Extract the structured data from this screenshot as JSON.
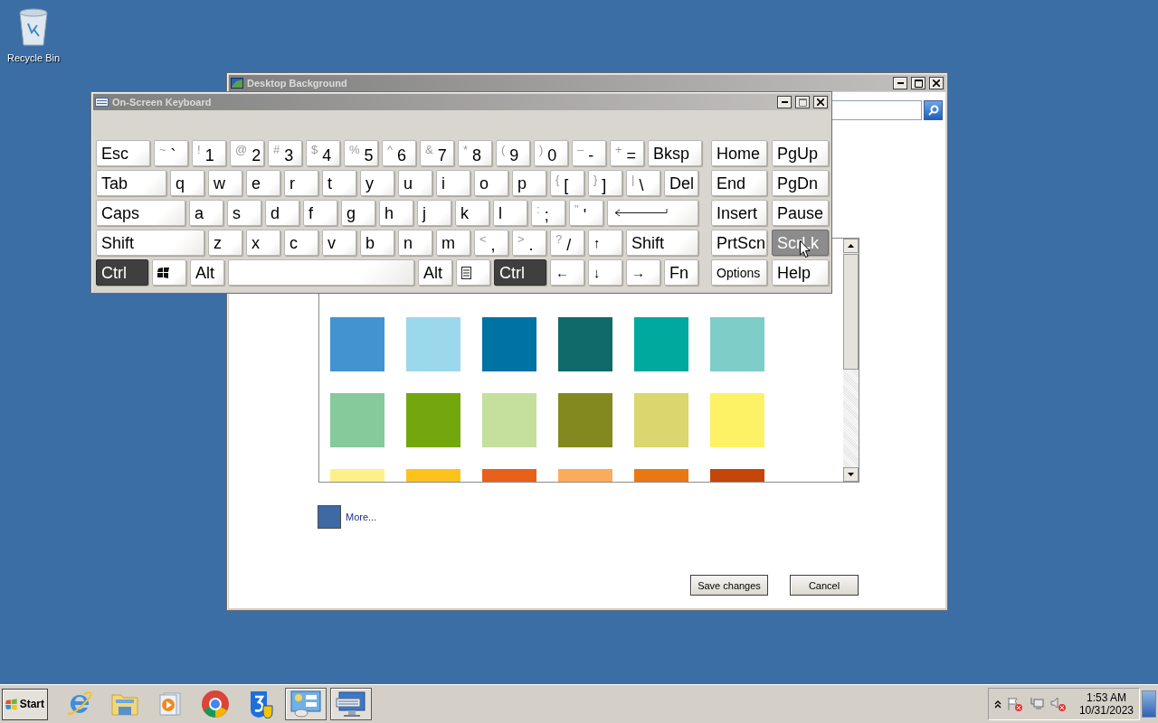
{
  "desktop": {
    "icons": [
      {
        "label": "Recycle Bin"
      }
    ]
  },
  "background_window": {
    "title": "Desktop Background",
    "swatch_rows": [
      [
        {
          "color": "#4393d0"
        },
        {
          "color": "#9cd8ec"
        },
        {
          "color": "#0072a3"
        },
        {
          "color": "#106a6a"
        },
        {
          "color": "#00a99d"
        },
        {
          "color": "#7ecdc8"
        }
      ],
      [
        {
          "color": "#86c99a"
        },
        {
          "color": "#72a80e"
        },
        {
          "color": "#c4e09c"
        },
        {
          "color": "#83891e"
        },
        {
          "color": "#dbd66e"
        },
        {
          "color": "#fdf266"
        }
      ],
      [
        {
          "color": "#fdf08a"
        },
        {
          "color": "#fec31b"
        },
        {
          "color": "#e8601c"
        },
        {
          "color": "#fcab5e"
        },
        {
          "color": "#e97812"
        },
        {
          "color": "#c44608"
        }
      ]
    ],
    "more": {
      "color": "#3d6aa3",
      "label": "More..."
    },
    "buttons": [
      "Save changes",
      "Cancel"
    ]
  },
  "keyboard_window": {
    "title": "On-Screen Keyboard",
    "key_rows": [
      {
        "keys": [
          {
            "kind": "text",
            "label": "Esc",
            "pressed": false,
            "hovered": false
          },
          {
            "kind": "text",
            "shift": "~",
            "label": "`",
            "pressed": false,
            "hovered": false
          },
          {
            "kind": "text",
            "shift": "!",
            "label": "1",
            "pressed": false,
            "hovered": false
          },
          {
            "kind": "text",
            "shift": "@",
            "label": "2",
            "pressed": false,
            "hovered": false
          },
          {
            "kind": "text",
            "shift": "#",
            "label": "3",
            "pressed": false,
            "hovered": false
          },
          {
            "kind": "text",
            "shift": "$",
            "label": "4",
            "pressed": false,
            "hovered": false
          },
          {
            "kind": "text",
            "shift": "%",
            "label": "5",
            "pressed": false,
            "hovered": false
          },
          {
            "kind": "text",
            "shift": "^",
            "label": "6",
            "pressed": false,
            "hovered": false
          },
          {
            "kind": "text",
            "shift": "&",
            "label": "7",
            "pressed": false,
            "hovered": false
          },
          {
            "kind": "text",
            "shift": "*",
            "label": "8",
            "pressed": false,
            "hovered": false
          },
          {
            "kind": "text",
            "shift": "(",
            "label": "9",
            "pressed": false,
            "hovered": false
          },
          {
            "kind": "text",
            "shift": ")",
            "label": "0",
            "pressed": false,
            "hovered": false
          },
          {
            "kind": "text",
            "shift": "–",
            "label": "-",
            "pressed": false,
            "hovered": false
          },
          {
            "kind": "text",
            "shift": "+",
            "label": "=",
            "pressed": false,
            "hovered": false
          },
          {
            "kind": "text",
            "label": "Bksp",
            "pressed": false,
            "hovered": false
          }
        ]
      },
      {
        "keys": [
          {
            "kind": "text",
            "label": "Tab",
            "pressed": false,
            "hovered": false
          },
          {
            "kind": "text",
            "label": "q",
            "pressed": false,
            "hovered": false
          },
          {
            "kind": "text",
            "label": "w",
            "pressed": false,
            "hovered": false
          },
          {
            "kind": "text",
            "label": "e",
            "pressed": false,
            "hovered": false
          },
          {
            "kind": "text",
            "label": "r",
            "pressed": false,
            "hovered": false
          },
          {
            "kind": "text",
            "label": "t",
            "pressed": false,
            "hovered": false
          },
          {
            "kind": "text",
            "label": "y",
            "pressed": false,
            "hovered": false
          },
          {
            "kind": "text",
            "label": "u",
            "pressed": false,
            "hovered": false
          },
          {
            "kind": "text",
            "label": "i",
            "pressed": false,
            "hovered": false
          },
          {
            "kind": "text",
            "label": "o",
            "pressed": false,
            "hovered": false
          },
          {
            "kind": "text",
            "label": "p",
            "pressed": false,
            "hovered": false
          },
          {
            "kind": "text",
            "shift": "{",
            "label": "[",
            "pressed": false,
            "hovered": false
          },
          {
            "kind": "text",
            "shift": "}",
            "label": "]",
            "pressed": false,
            "hovered": false
          },
          {
            "kind": "text",
            "shift": "|",
            "label": "\\",
            "pressed": false,
            "hovered": false
          },
          {
            "kind": "text",
            "label": "Del",
            "pressed": false,
            "hovered": false
          }
        ]
      },
      {
        "keys": [
          {
            "kind": "text",
            "label": "Caps",
            "pressed": false,
            "hovered": false
          },
          {
            "kind": "text",
            "label": "a",
            "pressed": false,
            "hovered": false
          },
          {
            "kind": "text",
            "label": "s",
            "pressed": false,
            "hovered": false
          },
          {
            "kind": "text",
            "label": "d",
            "pressed": false,
            "hovered": false
          },
          {
            "kind": "text",
            "label": "f",
            "pressed": false,
            "hovered": false
          },
          {
            "kind": "text",
            "label": "g",
            "pressed": false,
            "hovered": false
          },
          {
            "kind": "text",
            "label": "h",
            "pressed": false,
            "hovered": false
          },
          {
            "kind": "text",
            "label": "j",
            "pressed": false,
            "hovered": false
          },
          {
            "kind": "text",
            "label": "k",
            "pressed": false,
            "hovered": false
          },
          {
            "kind": "text",
            "label": "l",
            "pressed": false,
            "hovered": false
          },
          {
            "kind": "text",
            "shift": ":",
            "label": ";",
            "pressed": false,
            "hovered": false
          },
          {
            "kind": "text",
            "shift": "\"",
            "label": "'",
            "pressed": false,
            "hovered": false
          },
          {
            "kind": "enter",
            "pressed": false,
            "hovered": false
          }
        ]
      },
      {
        "keys": [
          {
            "kind": "text",
            "label": "Shift",
            "pressed": false,
            "hovered": false
          },
          {
            "kind": "text",
            "label": "z",
            "pressed": false,
            "hovered": false
          },
          {
            "kind": "text",
            "label": "x",
            "pressed": false,
            "hovered": false
          },
          {
            "kind": "text",
            "label": "c",
            "pressed": false,
            "hovered": false
          },
          {
            "kind": "text",
            "label": "v",
            "pressed": false,
            "hovered": false
          },
          {
            "kind": "text",
            "label": "b",
            "pressed": false,
            "hovered": false
          },
          {
            "kind": "text",
            "label": "n",
            "pressed": false,
            "hovered": false
          },
          {
            "kind": "text",
            "label": "m",
            "pressed": false,
            "hovered": false
          },
          {
            "kind": "text",
            "shift": "<",
            "label": ",",
            "pressed": false,
            "hovered": false
          },
          {
            "kind": "text",
            "shift": ">",
            "label": ".",
            "pressed": false,
            "hovered": false
          },
          {
            "kind": "text",
            "shift": "?",
            "label": "/",
            "pressed": false,
            "hovered": false
          },
          {
            "kind": "text",
            "shift": "↑",
            "pressed": false,
            "hovered": false
          },
          {
            "kind": "text",
            "label": "Shift",
            "pressed": false,
            "hovered": false
          }
        ]
      },
      {
        "keys": [
          {
            "kind": "text",
            "label": "Ctrl",
            "pressed": true,
            "hovered": false
          },
          {
            "kind": "windows",
            "pressed": false,
            "hovered": false
          },
          {
            "kind": "text",
            "label": "Alt",
            "pressed": false,
            "hovered": false
          },
          {
            "kind": "space",
            "pressed": false,
            "hovered": false
          },
          {
            "kind": "text",
            "label": "Alt",
            "pressed": false,
            "hovered": false
          },
          {
            "kind": "menu",
            "pressed": false,
            "hovered": false
          },
          {
            "kind": "text",
            "label": "Ctrl",
            "pressed": true,
            "hovered": false
          },
          {
            "kind": "text",
            "shift": "←",
            "pressed": false,
            "hovered": false
          },
          {
            "kind": "text",
            "shift": "↓",
            "pressed": false,
            "hovered": false
          },
          {
            "kind": "text",
            "shift": "→",
            "pressed": false,
            "hovered": false
          },
          {
            "kind": "text",
            "label": "Fn",
            "pressed": false,
            "hovered": false
          }
        ]
      }
    ],
    "side_key_rows": [
      {
        "keys": [
          {
            "kind": "text",
            "label": "Home",
            "pressed": false,
            "hovered": false
          },
          {
            "kind": "text",
            "label": "PgUp",
            "pressed": false,
            "hovered": false
          }
        ]
      },
      {
        "keys": [
          {
            "kind": "text",
            "label": "End",
            "pressed": false,
            "hovered": false
          },
          {
            "kind": "text",
            "label": "PgDn",
            "pressed": false,
            "hovered": false
          }
        ]
      },
      {
        "keys": [
          {
            "kind": "text",
            "label": "Insert",
            "pressed": false,
            "hovered": false
          },
          {
            "kind": "text",
            "label": "Pause",
            "pressed": false,
            "hovered": false
          }
        ]
      },
      {
        "keys": [
          {
            "kind": "text",
            "label": "PrtScn",
            "pressed": false,
            "hovered": false
          },
          {
            "kind": "text",
            "label": "ScrLk",
            "pressed": false,
            "hovered": true
          }
        ]
      },
      {
        "keys": [
          {
            "kind": "small",
            "label": "Options",
            "pressed": false,
            "hovered": false
          },
          {
            "kind": "text",
            "label": "Help",
            "pressed": false,
            "hovered": false
          }
        ]
      }
    ]
  },
  "taskbar": {
    "start": "Start",
    "apps": [
      {
        "kind": "ie",
        "running": false
      },
      {
        "kind": "folder",
        "running": false
      },
      {
        "kind": "media",
        "running": false
      },
      {
        "kind": "chrome",
        "running": false
      },
      {
        "kind": "shield",
        "running": false
      },
      {
        "kind": "control-panel",
        "running": true
      },
      {
        "kind": "keyboard",
        "running": true
      }
    ],
    "time": "1:53 AM",
    "date": "10/31/2023"
  }
}
